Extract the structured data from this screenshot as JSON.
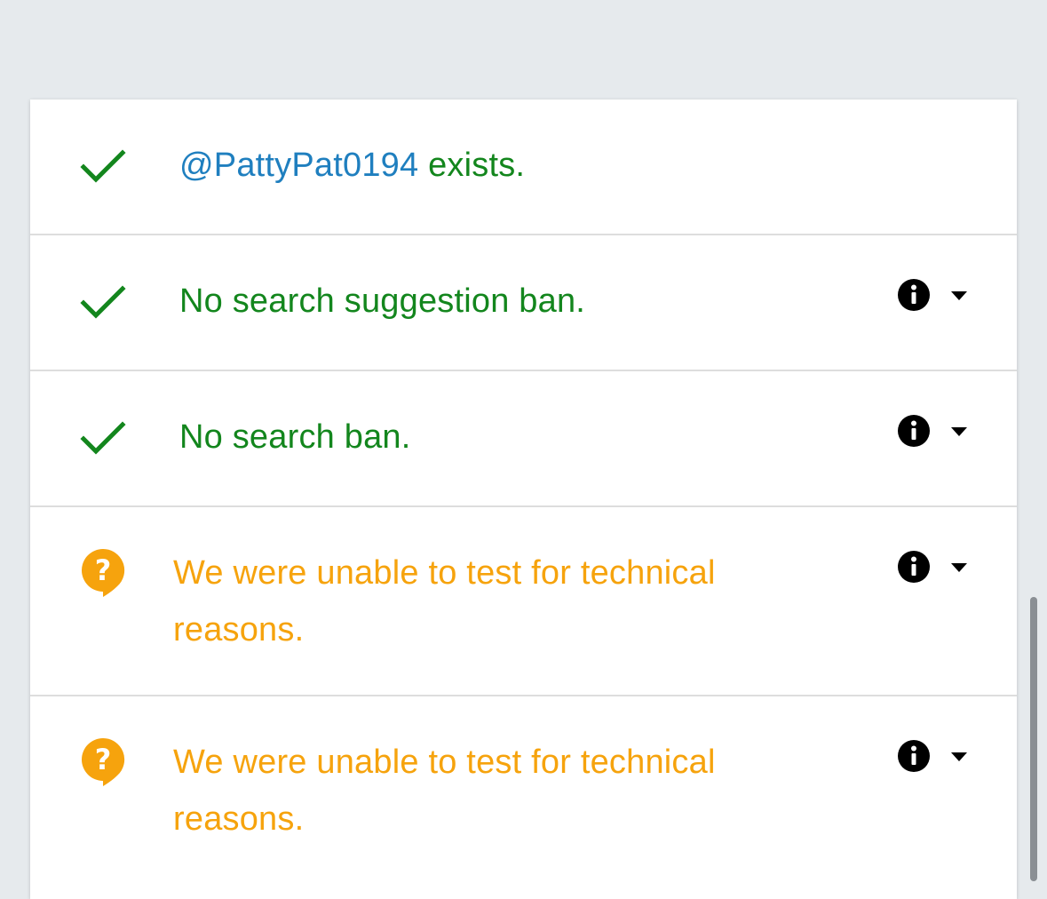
{
  "colors": {
    "success": "#13861d",
    "warning": "#f6a30d",
    "handle": "#1f7fbf",
    "background": "#e6eaed"
  },
  "results": [
    {
      "status_icon": "check-icon",
      "handle": "@PattyPat0194",
      "text": " exists.",
      "has_details": false
    },
    {
      "status_icon": "check-icon",
      "text": "No search suggestion ban.",
      "has_details": true,
      "details_icon": "info-icon",
      "toggle_icon": "caret-down-icon"
    },
    {
      "status_icon": "check-icon",
      "text": "No search ban.",
      "has_details": true,
      "details_icon": "info-icon",
      "toggle_icon": "caret-down-icon"
    },
    {
      "status_icon": "question-bubble-icon",
      "text": "We were unable to test for technical reasons.",
      "has_details": true,
      "details_icon": "info-icon",
      "toggle_icon": "caret-down-icon"
    },
    {
      "status_icon": "question-bubble-icon",
      "text": "We were unable to test for technical reasons.",
      "has_details": true,
      "details_icon": "info-icon",
      "toggle_icon": "caret-down-icon"
    }
  ]
}
